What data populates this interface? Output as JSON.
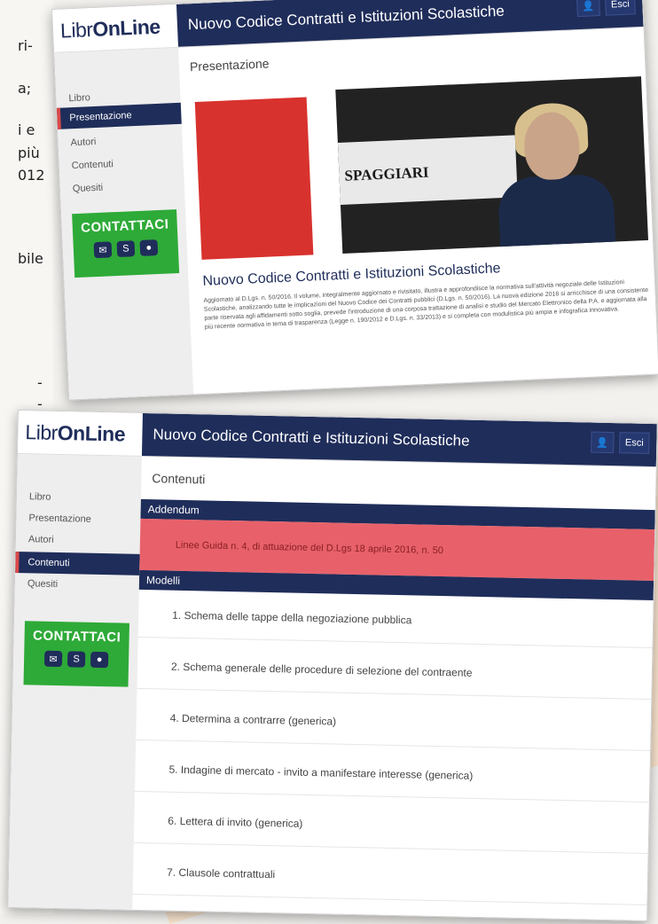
{
  "background": {
    "fragments": [
      "ri-",
      "a;",
      "i e",
      "più",
      "012",
      "bile",
      "-",
      "-",
      "-"
    ]
  },
  "colors": {
    "navy": "#1f2d5a",
    "red": "#d94a4a",
    "green": "#2eaa38",
    "addendum_red": "#e8616a"
  },
  "shot1": {
    "logo": {
      "part1": "Libr",
      "part2": "OnLine"
    },
    "app_title": "Nuovo Codice Contratti e Istituzioni Scolastiche",
    "user_icon": "user-icon",
    "logout_label": "Esci",
    "sidebar": [
      "Libro",
      "Presentazione",
      "Autori",
      "Contenuti",
      "Quesiti"
    ],
    "active_index": 1,
    "contact": {
      "label": "CONTATTACI",
      "icons": [
        "mail-icon",
        "skype-icon",
        "chat-icon"
      ]
    },
    "section_title": "Presentazione",
    "video_brand": "SPAGGIARI",
    "book_title": "Nuovo Codice Contratti e Istituzioni Scolastiche",
    "book_description": "Aggiornato al D.Lgs. n. 50/2016. Il volume, integralmente aggiornato e rivisitato, illustra e approfondisce la normativa sull'attività negoziale delle Istituzioni Scolastiche, analizzando tutte le implicazioni del Nuovo Codice dei Contratti pubblici (D.Lgs. n. 50/2016). La nuova edizione 2016 si arricchisce di una consistente parte riservata agli affidamenti sotto soglia, prevede l'introduzione di una corposa trattazione di analisi e studio del Mercato Elettronico della P.A. e aggiornata alla più recente normativa in tema di trasparenza (Legge n. 190/2012 e D.Lgs. n. 33/2013) e si completa con modulistica più ampia e infografica innovativa."
  },
  "shot2": {
    "logo": {
      "part1": "Libr",
      "part2": "OnLine"
    },
    "app_title": "Nuovo Codice Contratti e Istituzioni Scolastiche",
    "user_icon": "user-icon",
    "logout_label": "Esci",
    "sidebar": [
      "Libro",
      "Presentazione",
      "Autori",
      "Contenuti",
      "Quesiti"
    ],
    "active_index": 3,
    "contact": {
      "label": "CONTATTACI",
      "icons": [
        "mail-icon",
        "skype-icon",
        "chat-icon"
      ]
    },
    "section_title": "Contenuti",
    "addendum": {
      "header": "Addendum",
      "item": "Linee Guida n. 4, di attuazione del D.Lgs 18 aprile 2016, n. 50"
    },
    "modelli": {
      "header": "Modelli",
      "items": [
        "1. Schema delle tappe della negoziazione pubblica",
        "2. Schema generale delle procedure di selezione del contraente",
        "4. Determina a contrarre (generica)",
        "5. Indagine di mercato - invito a manifestare interesse (generica)",
        "6. Lettera di invito (generica)",
        "7. Clausole contrattuali"
      ]
    }
  }
}
